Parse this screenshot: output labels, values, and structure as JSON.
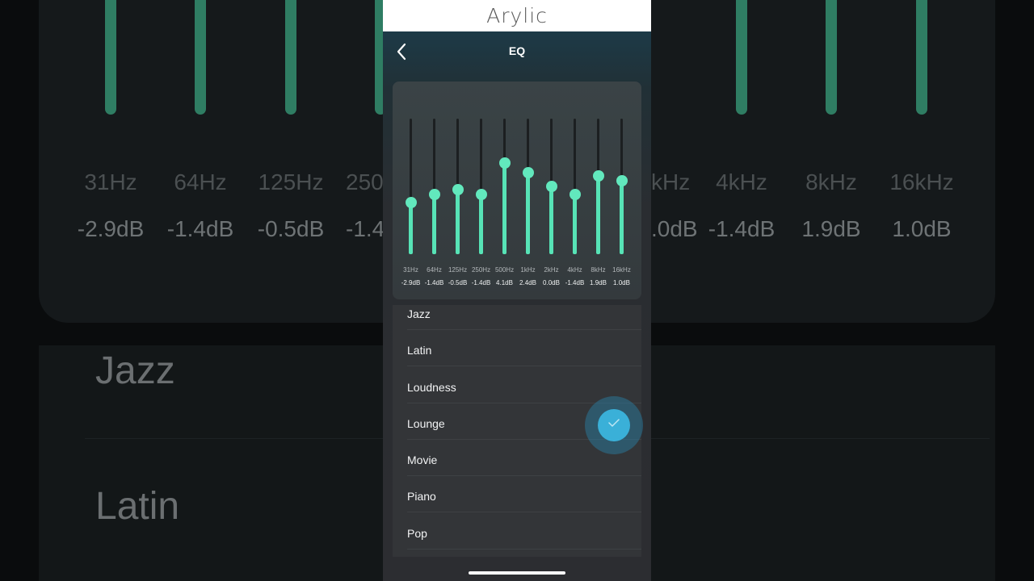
{
  "brand": {
    "name": "Arylic"
  },
  "header": {
    "title": "EQ",
    "back_icon": "chevron-left-icon"
  },
  "eq": {
    "min_db": -12,
    "max_db": 12,
    "accent_color": "#57e3b6",
    "bands": [
      {
        "freq": "31Hz",
        "db_label": "-2.9dB",
        "value": -2.9
      },
      {
        "freq": "64Hz",
        "db_label": "-1.4dB",
        "value": -1.4
      },
      {
        "freq": "125Hz",
        "db_label": "-0.5dB",
        "value": -0.5
      },
      {
        "freq": "250Hz",
        "db_label": "-1.4dB",
        "value": -1.4
      },
      {
        "freq": "500Hz",
        "db_label": "4.1dB",
        "value": 4.1
      },
      {
        "freq": "1kHz",
        "db_label": "2.4dB",
        "value": 2.4
      },
      {
        "freq": "2kHz",
        "db_label": "0.0dB",
        "value": 0.0
      },
      {
        "freq": "4kHz",
        "db_label": "-1.4dB",
        "value": -1.4
      },
      {
        "freq": "8kHz",
        "db_label": "1.9dB",
        "value": 1.9
      },
      {
        "freq": "16kHz",
        "db_label": "1.0dB",
        "value": 1.0
      }
    ]
  },
  "presets": {
    "items": [
      "Jazz",
      "Latin",
      "Loudness",
      "Lounge",
      "Movie",
      "Piano",
      "Pop"
    ]
  },
  "fab": {
    "icon": "check-icon",
    "color": "#3ab0d8"
  },
  "background": {
    "freqs": [
      "31Hz",
      "64Hz",
      "125Hz",
      "250",
      "",
      "",
      "",
      "kHz",
      "4kHz",
      "8kHz",
      "16kHz"
    ],
    "dbs": [
      "-2.9dB",
      "-1.4dB",
      "-0.5dB",
      "-1.4",
      "",
      "",
      "",
      ".0dB",
      "-1.4dB",
      "1.9dB",
      "1.0dB"
    ],
    "items": [
      "Jazz",
      "Latin"
    ]
  }
}
